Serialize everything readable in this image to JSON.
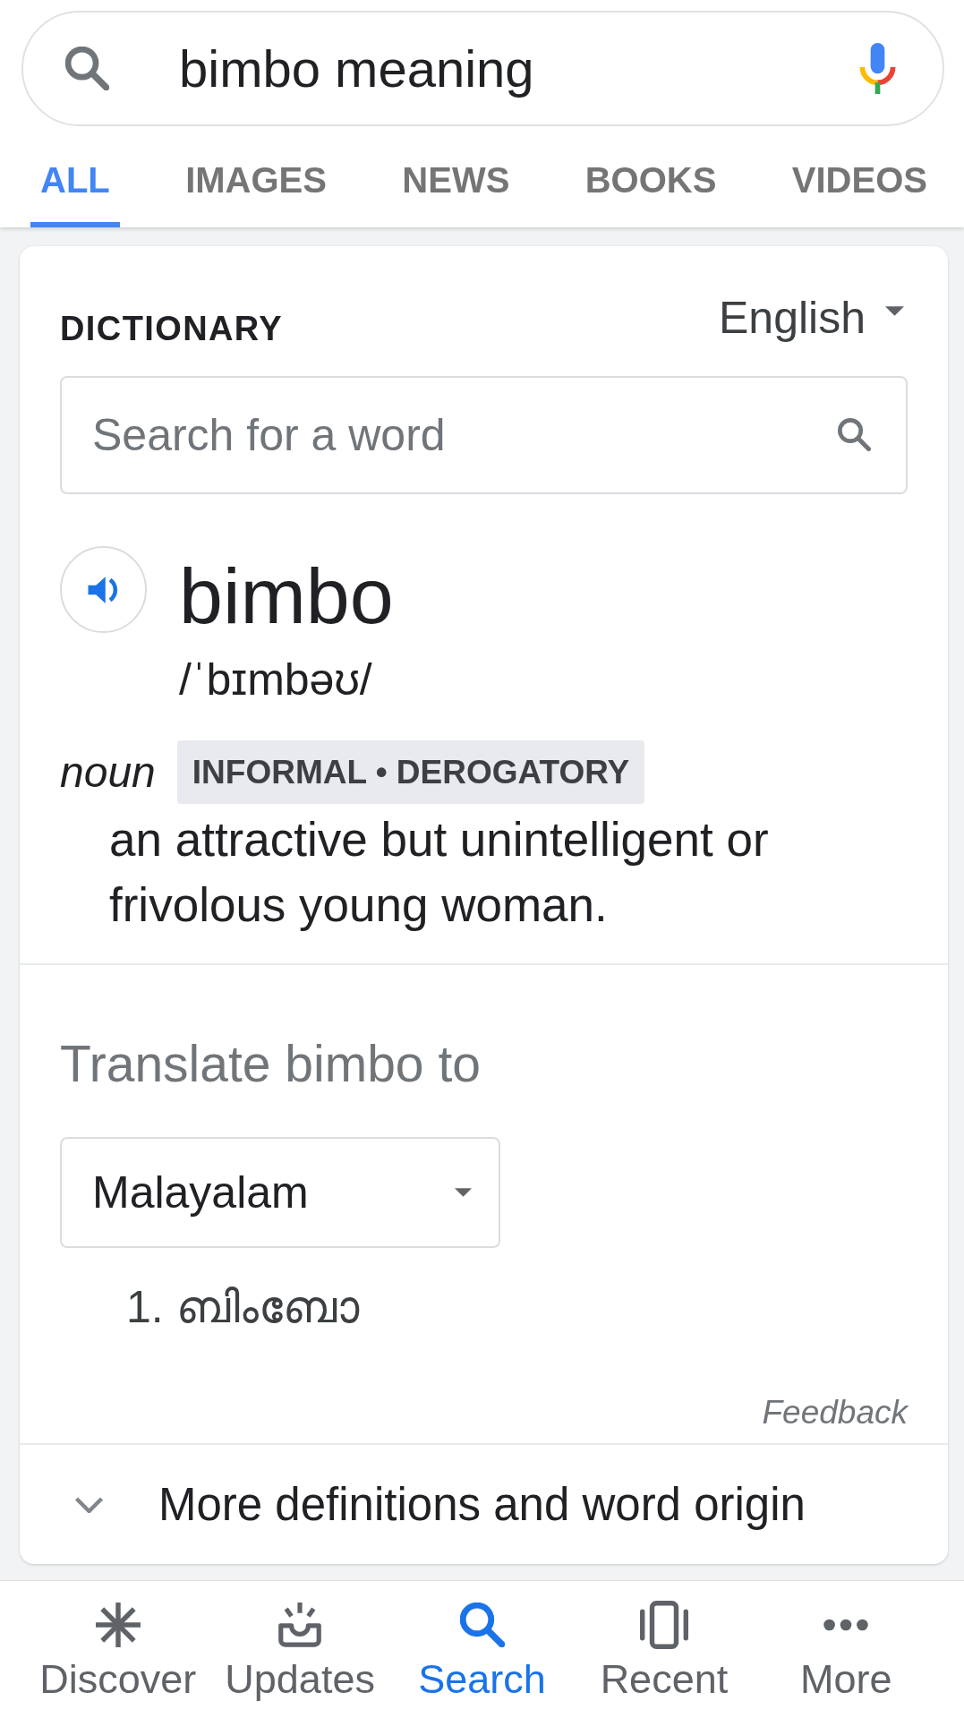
{
  "search_bar": {
    "query": "bimbo meaning"
  },
  "tabs": [
    {
      "label": "ALL",
      "selected": true
    },
    {
      "label": "IMAGES",
      "selected": false
    },
    {
      "label": "NEWS",
      "selected": false
    },
    {
      "label": "BOOKS",
      "selected": false
    },
    {
      "label": "VIDEOS",
      "selected": false
    }
  ],
  "dictionary": {
    "title": "DICTIONARY",
    "language": "English",
    "word_search": {
      "placeholder": "Search for a word"
    },
    "word": "bimbo",
    "pronunciation": "/ˈbɪmbəʊ/",
    "part_of_speech": "noun",
    "usage_labels": "INFORMAL • DEROGATORY",
    "definition": "an attractive but unintelligent or frivolous young woman."
  },
  "translate": {
    "heading": "Translate bimbo to",
    "language": "Malayalam",
    "results": [
      {
        "number": "1.",
        "text": "ബിംബോ"
      }
    ]
  },
  "feedback": "Feedback",
  "more_link": "More definitions and word origin",
  "bottom_nav": [
    {
      "label": "Discover",
      "selected": false
    },
    {
      "label": "Updates",
      "selected": false
    },
    {
      "label": "Search",
      "selected": true
    },
    {
      "label": "Recent",
      "selected": false
    },
    {
      "label": "More",
      "selected": false
    }
  ]
}
